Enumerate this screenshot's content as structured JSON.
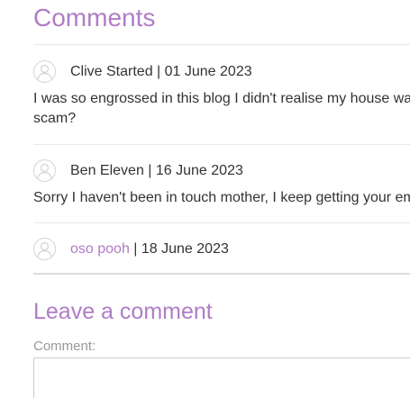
{
  "page": {
    "title": "Comments"
  },
  "comments": [
    {
      "author": "Clive Started",
      "date": "01 June 2023",
      "body_line1": "I was so engrossed in this blog I didn't realise my house was",
      "body_line2": "scam?"
    },
    {
      "author": "Ben Eleven",
      "date": "16 June 2023",
      "body_line1": "Sorry I haven't been in touch mother, I keep getting your emails"
    },
    {
      "author": "oso pooh",
      "date": "18 June 2023"
    }
  ],
  "separator": " | ",
  "leave_comment": {
    "title": "Leave a comment",
    "comment_label": "Comment:"
  },
  "colors": {
    "accent": "#b07cc6",
    "text": "#333333",
    "muted": "#999999"
  }
}
